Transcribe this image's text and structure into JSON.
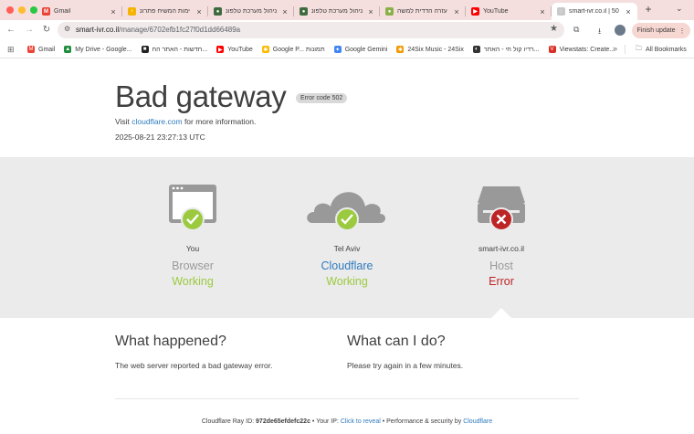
{
  "tabs": [
    {
      "label": "Gmail",
      "icon": "gmail-icon",
      "color": "#ea4335",
      "glyph": "M",
      "active": false
    },
    {
      "label": "ימות המשיח פתרונ",
      "icon": "yemot-icon",
      "color": "#f4b400",
      "glyph": "י",
      "active": false
    },
    {
      "label": "ניהול מערכת טלפונ",
      "icon": "ivr-icon",
      "color": "#3d6b3d",
      "glyph": "●",
      "active": false
    },
    {
      "label": "ניהול מערכת טלפונ",
      "icon": "ivr-icon",
      "color": "#3d6b3d",
      "glyph": "●",
      "active": false
    },
    {
      "label": "עזרה הדדית למשה",
      "icon": "site-icon",
      "color": "#8bb04a",
      "glyph": "●",
      "active": false
    },
    {
      "label": "YouTube",
      "icon": "youtube-icon",
      "color": "#ff0000",
      "glyph": "▶",
      "active": false
    },
    {
      "label": "smart-ivr.co.il | 50",
      "icon": "loading-globe-icon",
      "color": "#c9c9c9",
      "glyph": "◌",
      "active": true
    }
  ],
  "toolbar": {
    "url_host": "smart-ivr.co.il",
    "url_path": "/manage/6702efb1fc27f0d1dd66489a",
    "finish_update": "Finish update"
  },
  "bookmarks": [
    {
      "label": "Gmail",
      "icon": "gmail-icon",
      "color": "#ea4335",
      "glyph": "M"
    },
    {
      "label": "My Drive - Google...",
      "icon": "drive-icon",
      "color": "#1e8e3e",
      "glyph": "▲"
    },
    {
      "label": "חדשות - האתר הח...",
      "icon": "news-icon",
      "color": "#222222",
      "glyph": "■"
    },
    {
      "label": "YouTube",
      "icon": "youtube-icon",
      "color": "#ff0000",
      "glyph": "▶"
    },
    {
      "label": "Google P... תמונות",
      "icon": "photos-icon",
      "color": "#fbbc04",
      "glyph": "✱"
    },
    {
      "label": "Google Gemini",
      "icon": "gemini-icon",
      "color": "#4285f4",
      "glyph": "✦"
    },
    {
      "label": "24Six Music - 24Six",
      "icon": "24six-icon",
      "color": "#f29900",
      "glyph": "✱"
    },
    {
      "label": "רדיו קול חי - האתר...",
      "icon": "radio-icon",
      "color": "#333333",
      "glyph": "◐"
    },
    {
      "label": "Viewstats: Create...",
      "icon": "viewstats-icon",
      "color": "#d93025",
      "glyph": "V"
    }
  ],
  "all_bookmarks": "All Bookmarks",
  "error": {
    "title": "Bad gateway",
    "code": "Error code 502",
    "visit_prefix": "Visit",
    "visit_link": "cloudflare.com",
    "visit_suffix": "for more information.",
    "timestamp": "2025-08-21 23:27:13 UTC"
  },
  "nodes": [
    {
      "place": "You",
      "kind": "Browser",
      "status": "Working",
      "state": "ok"
    },
    {
      "place": "Tel Aviv",
      "kind": "Cloudflare",
      "status": "Working",
      "state": "ok"
    },
    {
      "place": "smart-ivr.co.il",
      "kind": "Host",
      "status": "Error",
      "state": "error"
    }
  ],
  "what_happened": {
    "heading": "What happened?",
    "body": "The web server reported a bad gateway error."
  },
  "what_can_i_do": {
    "heading": "What can I do?",
    "body": "Please try again in a few minutes."
  },
  "footer": {
    "ray_label": "Cloudflare Ray ID:",
    "ray_id": "972de65efdefc22c",
    "sep1": "•",
    "ip_label": "Your IP:",
    "ip_link": "Click to reveal",
    "sep2": "•",
    "perf": "Performance & security by",
    "perf_link": "Cloudflare"
  },
  "colors": {
    "ok": "#9bca3e",
    "error": "#bd2426",
    "link": "#2f7bbf",
    "icon_gray": "#999999"
  }
}
